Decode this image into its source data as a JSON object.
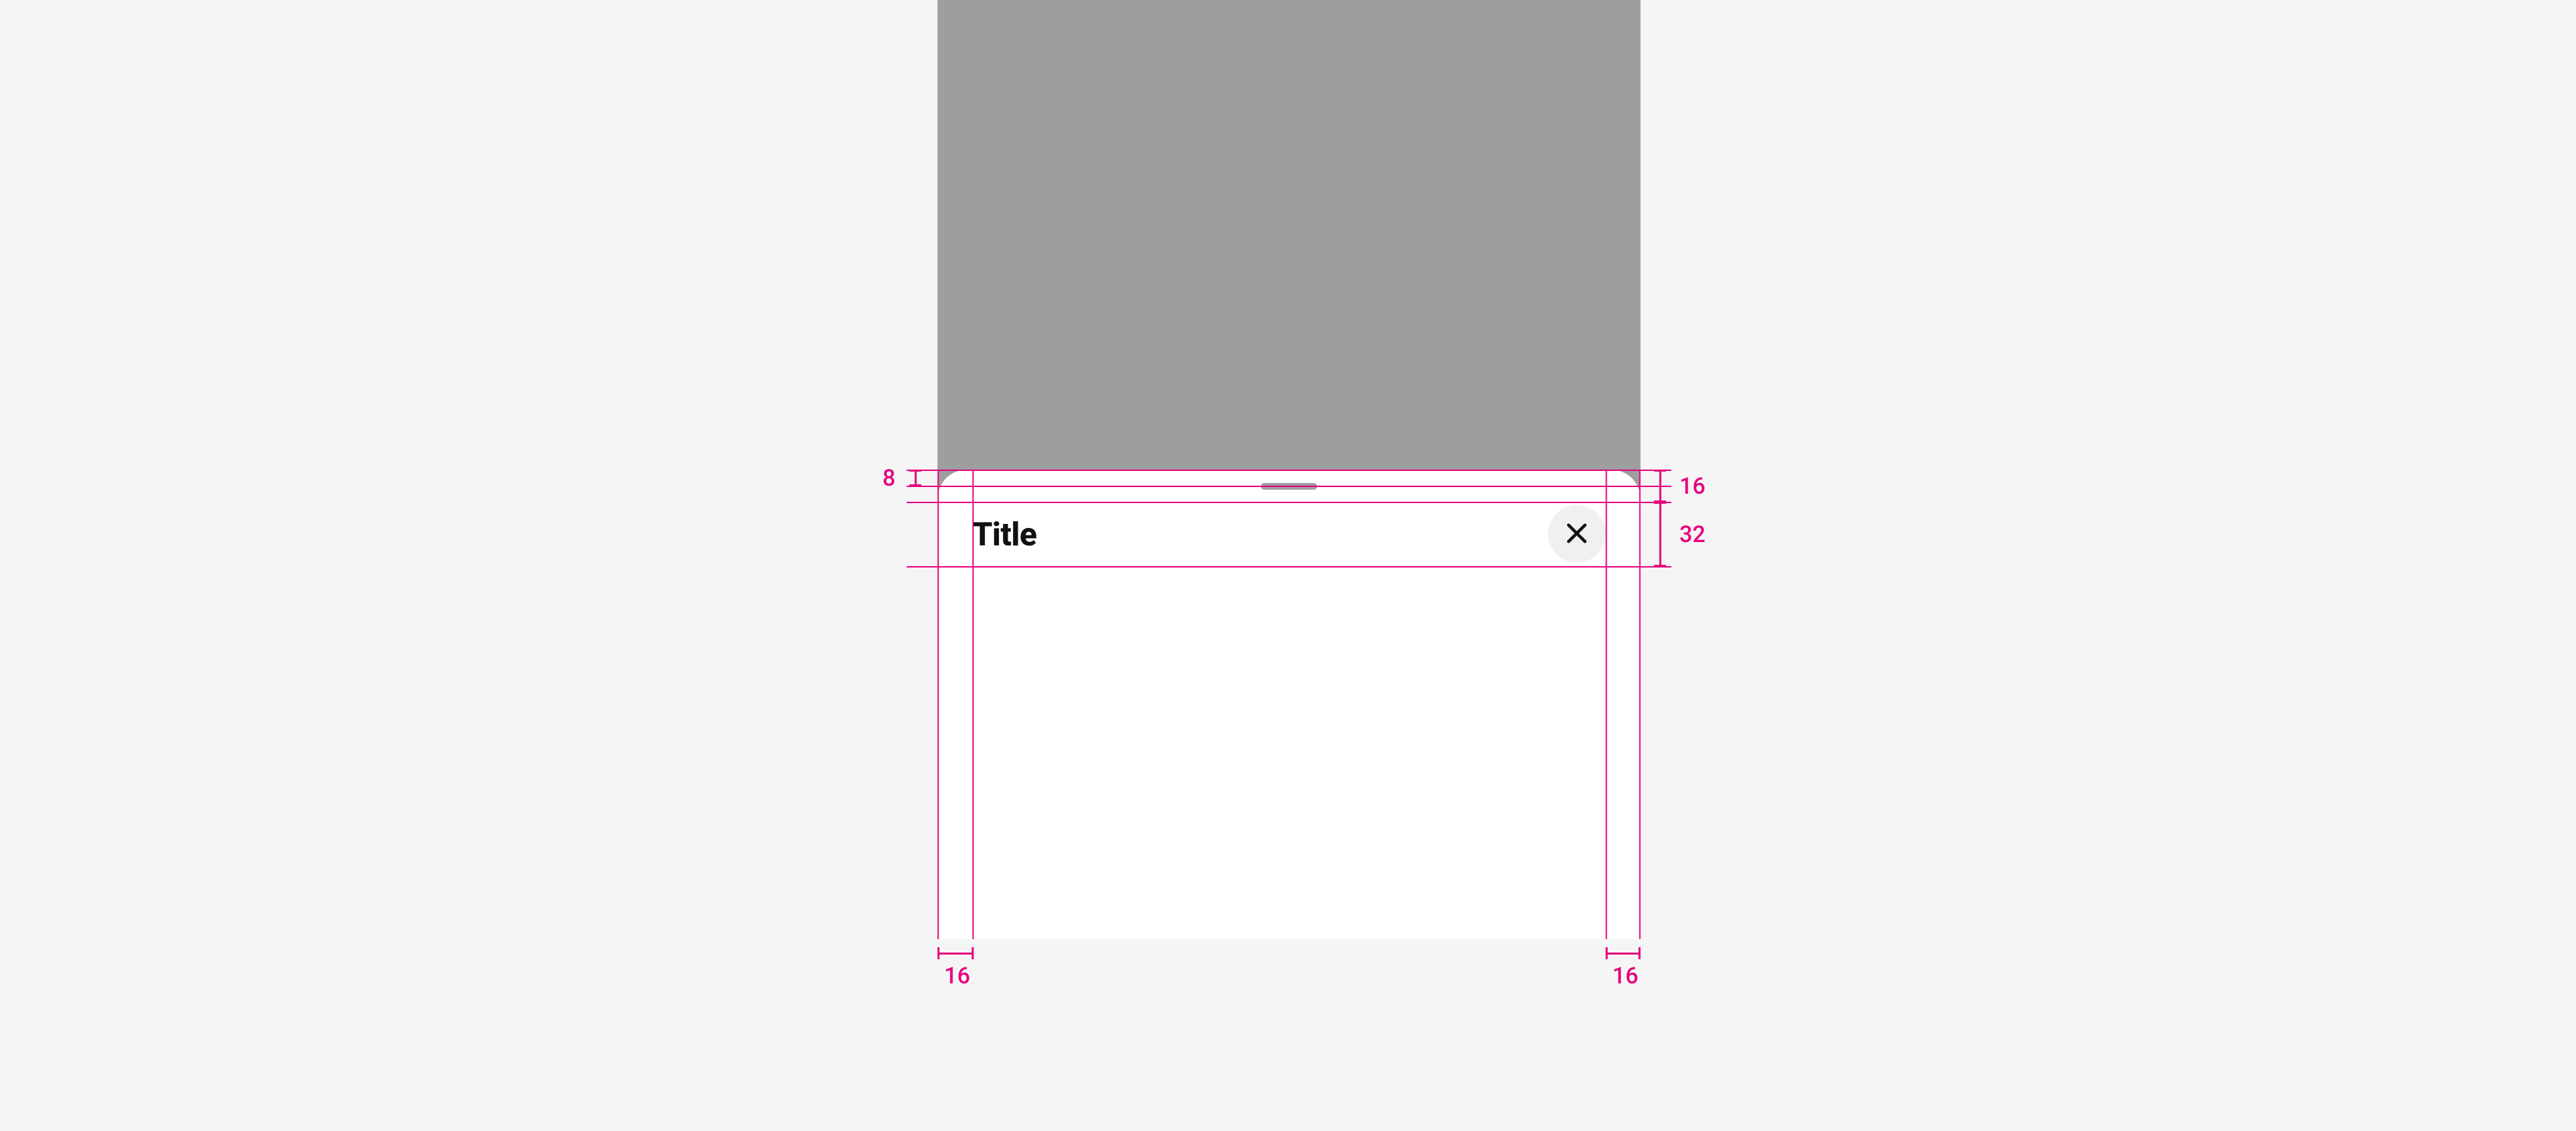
{
  "sheet": {
    "title": "Title"
  },
  "annotations": {
    "top_handle_gap": "8",
    "header_top_gap": "16",
    "header_height": "32",
    "padding_left": "16",
    "padding_right": "16"
  },
  "colors": {
    "redline": "#e6007e",
    "backdrop": "#9e9e9e",
    "sheet_bg": "#ffffff",
    "close_bg": "#f0f0f0"
  }
}
